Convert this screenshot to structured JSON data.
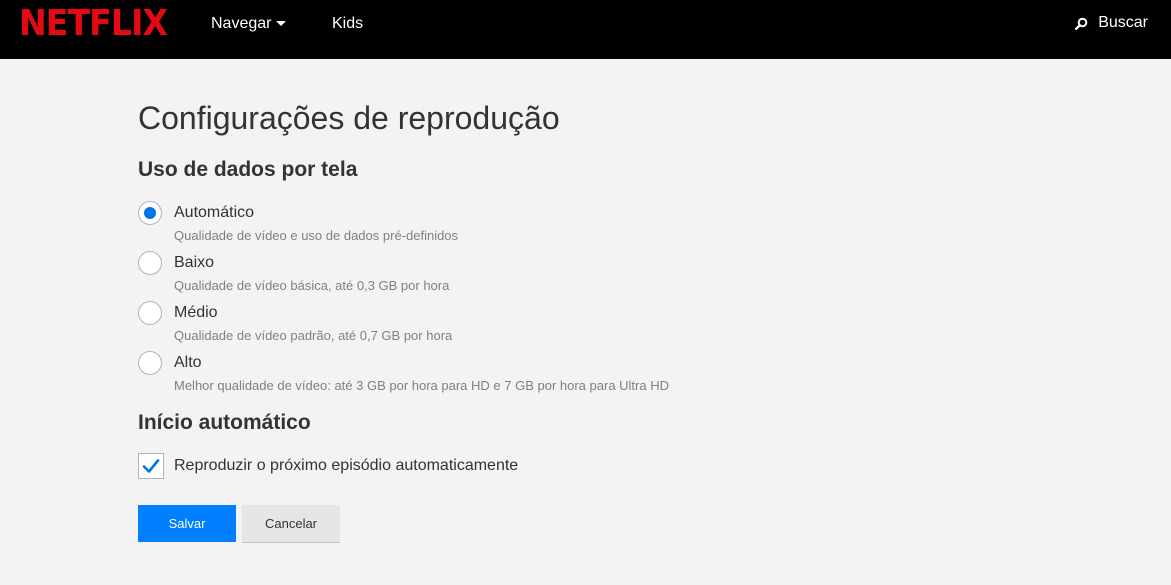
{
  "header": {
    "logo": "NETFLIX",
    "nav": {
      "browse": "Navegar",
      "kids": "Kids"
    },
    "search_label": "Buscar"
  },
  "page": {
    "title": "Configurações de reprodução",
    "data_usage": {
      "title": "Uso de dados por tela",
      "selected": "auto",
      "options": [
        {
          "id": "auto",
          "label": "Automático",
          "desc": "Qualidade de vídeo e uso de dados pré-definidos"
        },
        {
          "id": "low",
          "label": "Baixo",
          "desc": "Qualidade de vídeo básica, até 0,3 GB por hora"
        },
        {
          "id": "medium",
          "label": "Médio",
          "desc": "Qualidade de vídeo padrão, até 0,7 GB por hora"
        },
        {
          "id": "high",
          "label": "Alto",
          "desc": "Melhor qualidade de vídeo: até 3 GB por hora para HD e 7 GB por hora para Ultra HD"
        }
      ]
    },
    "autoplay": {
      "title": "Início automático",
      "next_episode_label": "Reproduzir o próximo episódio automaticamente",
      "next_episode_checked": true
    },
    "buttons": {
      "save": "Salvar",
      "cancel": "Cancelar"
    }
  },
  "colors": {
    "brand": "#e50914",
    "accent": "#0080ff",
    "radio_selected": "#0073e6",
    "checkmark": "#0073e6",
    "background": "#f3f3f3",
    "header_bg": "#000000"
  },
  "icons": {
    "search": "search-icon",
    "caret": "caret-down-icon",
    "check": "check-icon"
  }
}
